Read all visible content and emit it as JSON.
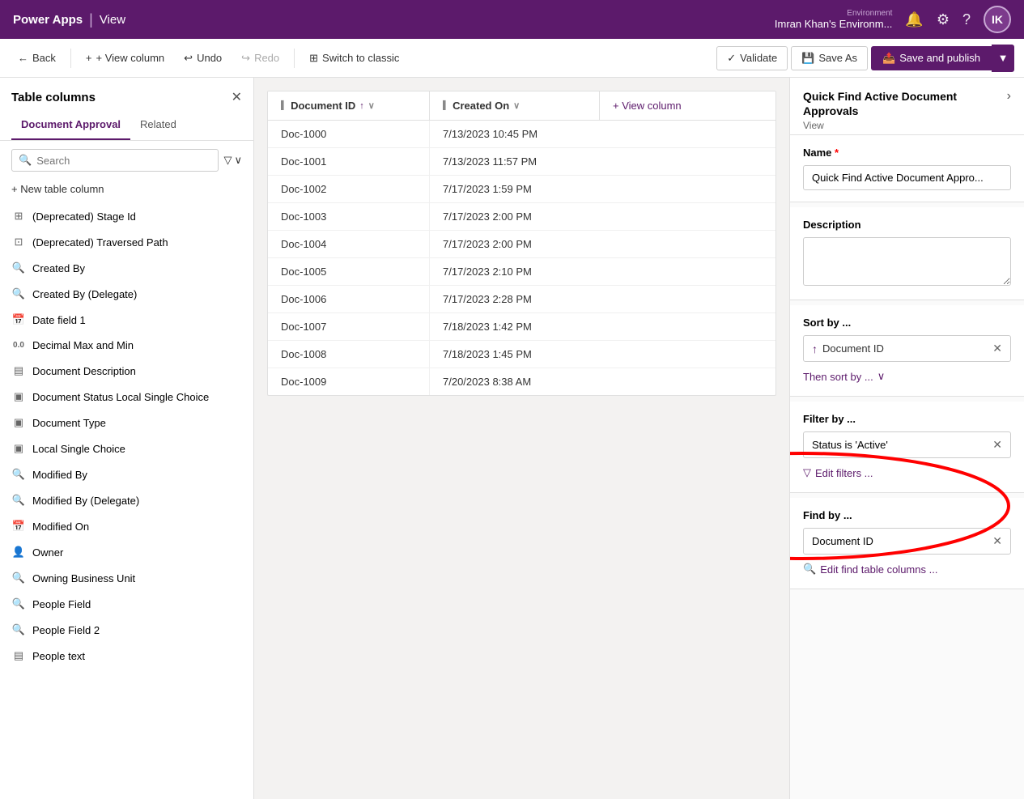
{
  "app": {
    "title": "Power Apps",
    "separator": "|",
    "section": "View"
  },
  "topbar": {
    "env_label": "Environment",
    "env_name": "Imran Khan's Environm...",
    "avatar_initials": "IK"
  },
  "cmdbar": {
    "back": "Back",
    "view_column": "+ View column",
    "undo": "Undo",
    "redo": "Redo",
    "switch_classic": "Switch to classic",
    "validate": "Validate",
    "save_as": "Save As",
    "save_publish": "Save and publish"
  },
  "left_panel": {
    "title": "Table columns",
    "tab_document": "Document Approval",
    "tab_related": "Related",
    "search_placeholder": "Search",
    "new_column": "+ New table column",
    "columns": [
      {
        "icon": "grid",
        "label": "(Deprecated) Stage Id"
      },
      {
        "icon": "grid2",
        "label": "(Deprecated) Traversed Path"
      },
      {
        "icon": "search-circle",
        "label": "Created By"
      },
      {
        "icon": "search-circle",
        "label": "Created By (Delegate)"
      },
      {
        "icon": "calendar",
        "label": "Date field 1"
      },
      {
        "icon": "decimal",
        "label": "Decimal Max and Min"
      },
      {
        "icon": "text-grid",
        "label": "Document Description"
      },
      {
        "icon": "choice",
        "label": "Document Status Local Single Choice"
      },
      {
        "icon": "choice",
        "label": "Document Type"
      },
      {
        "icon": "choice",
        "label": "Local Single Choice"
      },
      {
        "icon": "search-circle",
        "label": "Modified By"
      },
      {
        "icon": "search-circle",
        "label": "Modified By (Delegate)"
      },
      {
        "icon": "calendar2",
        "label": "Modified On"
      },
      {
        "icon": "person",
        "label": "Owner"
      },
      {
        "icon": "search-circle",
        "label": "Owning Business Unit"
      },
      {
        "icon": "search-circle",
        "label": "People Field"
      },
      {
        "icon": "search-circle",
        "label": "People Field 2"
      },
      {
        "icon": "text-grid",
        "label": "People text"
      }
    ]
  },
  "table": {
    "col1_label": "Document ID",
    "col2_label": "Created On",
    "add_col_label": "+ View column",
    "rows": [
      {
        "id": "Doc-1000",
        "date": "7/13/2023 10:45 PM"
      },
      {
        "id": "Doc-1001",
        "date": "7/13/2023 11:57 PM"
      },
      {
        "id": "Doc-1002",
        "date": "7/17/2023 1:59 PM"
      },
      {
        "id": "Doc-1003",
        "date": "7/17/2023 2:00 PM"
      },
      {
        "id": "Doc-1004",
        "date": "7/17/2023 2:00 PM"
      },
      {
        "id": "Doc-1005",
        "date": "7/17/2023 2:10 PM"
      },
      {
        "id": "Doc-1006",
        "date": "7/17/2023 2:28 PM"
      },
      {
        "id": "Doc-1007",
        "date": "7/18/2023 1:42 PM"
      },
      {
        "id": "Doc-1008",
        "date": "7/18/2023 1:45 PM"
      },
      {
        "id": "Doc-1009",
        "date": "7/20/2023 8:38 AM"
      }
    ]
  },
  "right_panel": {
    "title": "Quick Find Active Document Approvals",
    "subtitle": "View",
    "name_label": "Name",
    "name_required": "*",
    "name_value": "Quick Find Active Document Appro...",
    "description_label": "Description",
    "description_value": "",
    "sort_label": "Sort by ...",
    "sort_field": "Document ID",
    "then_sort_label": "Then sort by ...",
    "filter_label": "Filter by ...",
    "filter_value": "Status is 'Active'",
    "edit_filters": "Edit filters ...",
    "find_label": "Find by ...",
    "find_value": "Document ID",
    "edit_find": "Edit find table columns ..."
  }
}
